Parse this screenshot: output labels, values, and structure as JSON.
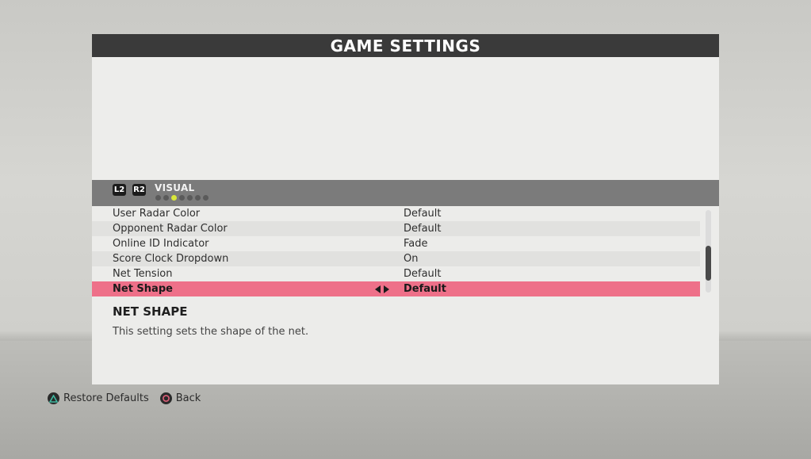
{
  "window": {
    "title": "GAME SETTINGS"
  },
  "tabs": {
    "left_trigger": "L2",
    "right_trigger": "R2",
    "current_label": "VISUAL",
    "page_count": 7,
    "active_page": 2
  },
  "settings": [
    {
      "name": "User Radar Color",
      "value": "Default"
    },
    {
      "name": "Opponent Radar Color",
      "value": "Default"
    },
    {
      "name": "Online ID Indicator",
      "value": "Fade"
    },
    {
      "name": "Score Clock Dropdown",
      "value": "On"
    },
    {
      "name": "Net Tension",
      "value": "Default"
    },
    {
      "name": "Net Shape",
      "value": "Default"
    }
  ],
  "selected_index": 5,
  "description": {
    "title": "NET SHAPE",
    "text": "This setting sets the shape of the net."
  },
  "footer": {
    "restore_label": "Restore Defaults",
    "back_label": "Back"
  },
  "colors": {
    "selected_row": "#ee7089",
    "active_dot": "#d9e83a",
    "triangle_button": "#3fb8a0",
    "circle_button": "#e0607a"
  },
  "icons": {
    "restore": "triangle-button-icon",
    "back": "circle-button-icon",
    "option_prev": "arrow-left-icon",
    "option_next": "arrow-right-icon"
  }
}
